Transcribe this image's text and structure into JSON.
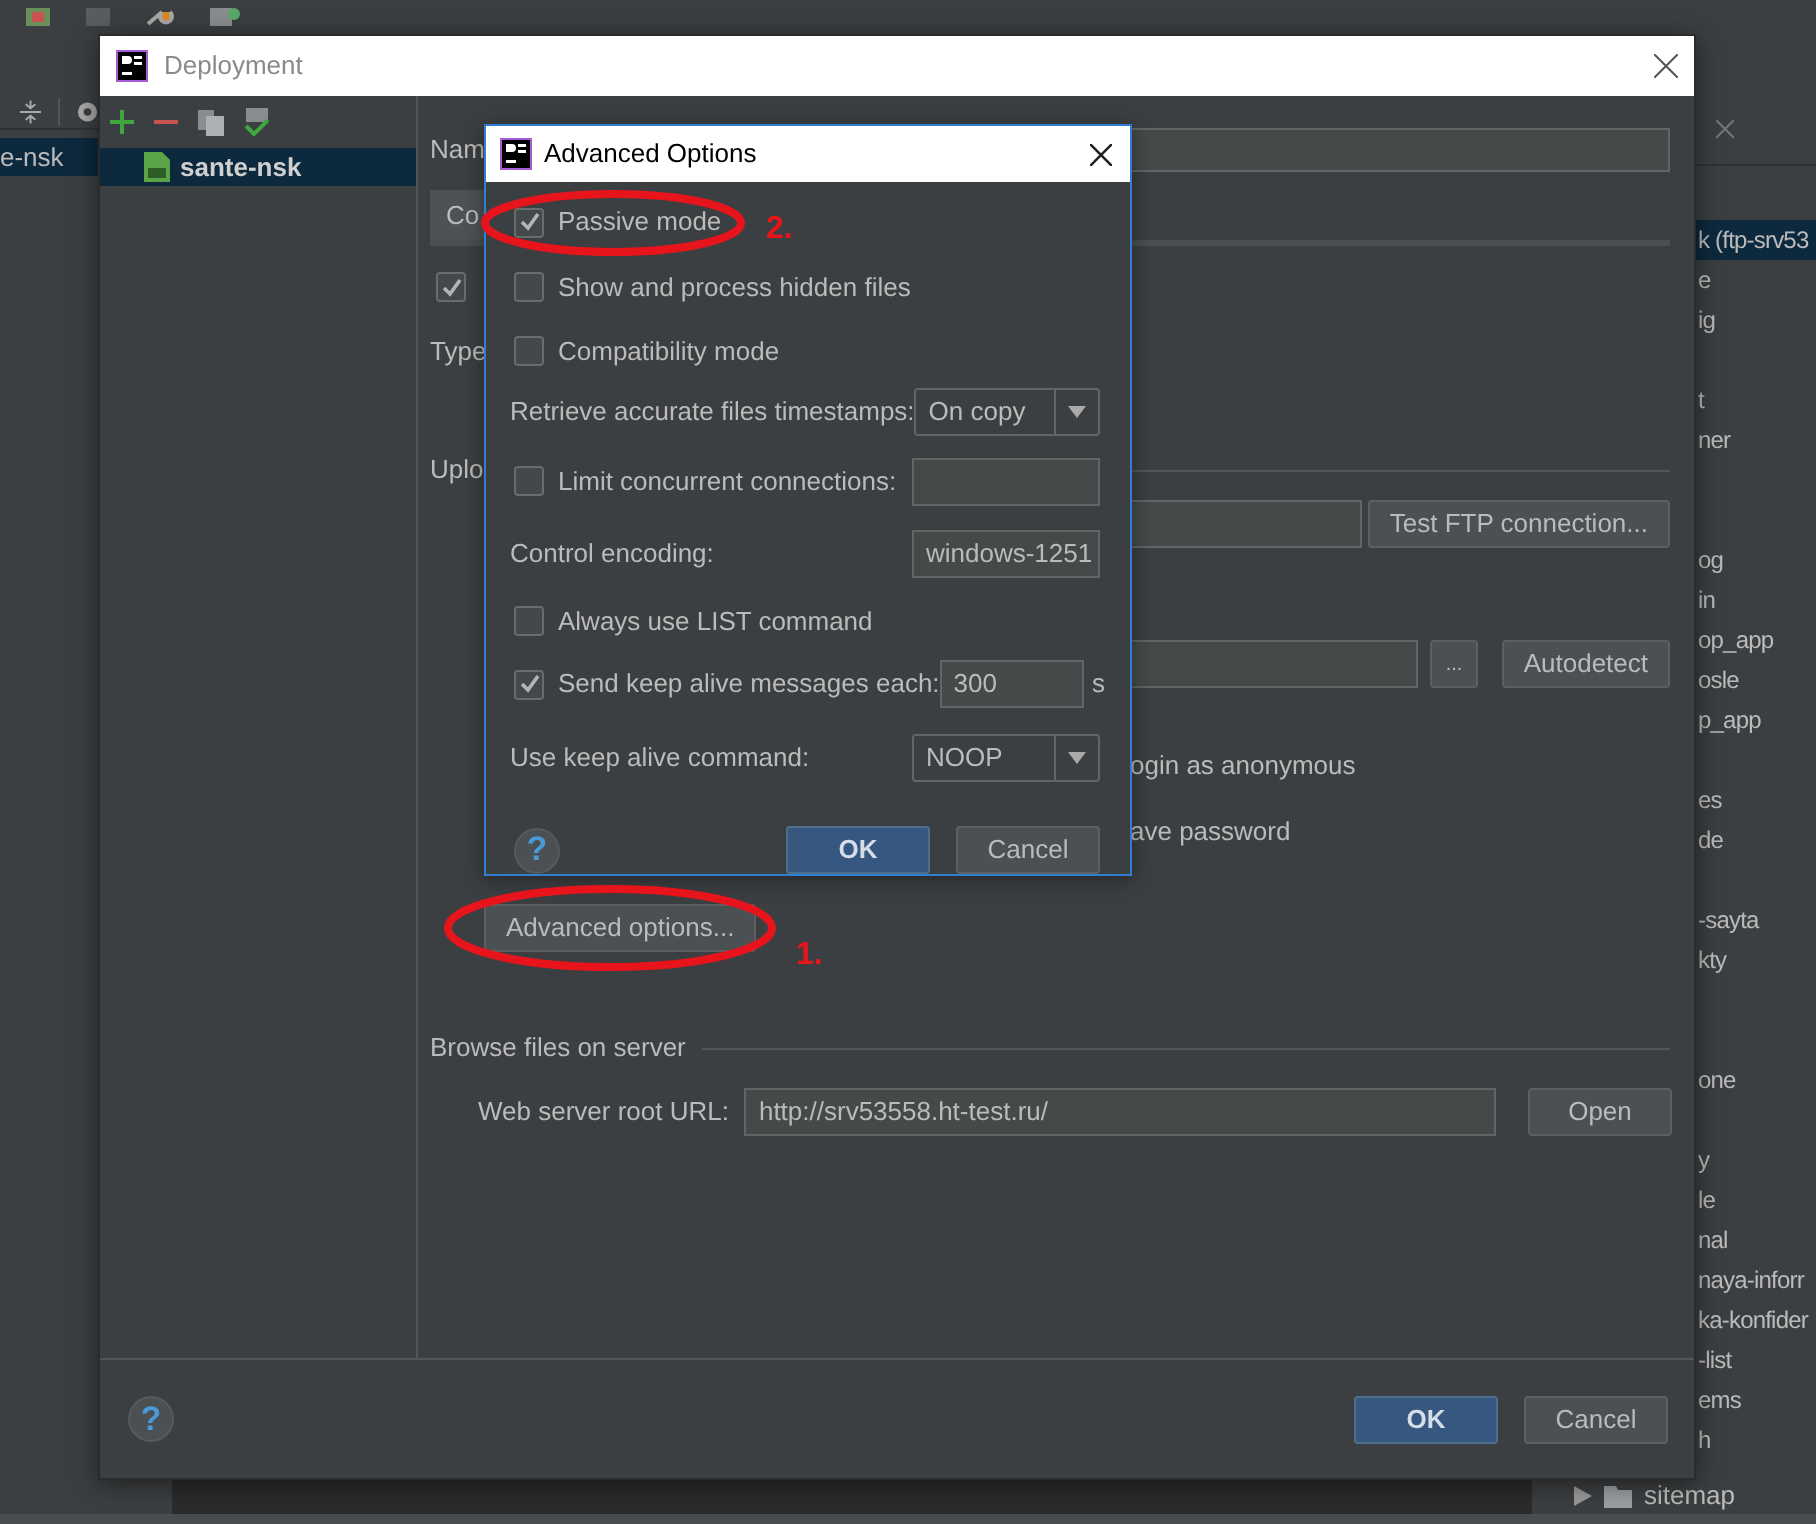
{
  "ide": {
    "left_item": {
      "label": "e-nsk",
      "selected": true
    },
    "right_items": [
      {
        "label": "k (ftp-srv53",
        "selected": true
      },
      {
        "label": "e",
        "selected": false
      },
      {
        "label": "ig",
        "selected": false
      },
      {
        "label": "t",
        "selected": false
      },
      {
        "label": "ner",
        "selected": false
      },
      {
        "label": "og",
        "selected": false
      },
      {
        "label": "in",
        "selected": false
      },
      {
        "label": "op_app",
        "selected": false
      },
      {
        "label": "osle",
        "selected": false
      },
      {
        "label": "p_app",
        "selected": false
      },
      {
        "label": "es",
        "selected": false
      },
      {
        "label": "de",
        "selected": false
      },
      {
        "label": "-sayta",
        "selected": false
      },
      {
        "label": "kty",
        "selected": false
      },
      {
        "label": "one",
        "selected": false
      },
      {
        "label": "y",
        "selected": false
      },
      {
        "label": "le",
        "selected": false
      },
      {
        "label": "nal",
        "selected": false
      },
      {
        "label": "naya-inforr",
        "selected": false
      },
      {
        "label": "ka-konfider",
        "selected": false
      },
      {
        "label": "-list",
        "selected": false
      },
      {
        "label": "ems",
        "selected": false
      },
      {
        "label": "h",
        "selected": false
      },
      {
        "label": "sitemap",
        "selected": false,
        "kind": "folder"
      }
    ]
  },
  "deployment": {
    "title": "Deployment",
    "servers": [
      {
        "label": "sante-nsk",
        "selected": true
      }
    ],
    "name_label": "Nam",
    "tabs": [
      {
        "label": "Co",
        "selected": true
      }
    ],
    "visible_checkbox": {
      "checked": true
    },
    "type_label": "Type",
    "upload_label": "Uplo",
    "test_button": "Test FTP connection...",
    "browse_button": "...",
    "autodetect_button": "Autodetect",
    "anonymous_label": "ogin as anonymous",
    "save_password_label": "ave password",
    "advanced_button": "Advanced options...",
    "browse_section": "Browse files on server",
    "web_root_label": "Web server root URL:",
    "web_root_value": "http://srv53558.ht-test.ru/",
    "open_button": "Open",
    "help_label": "?",
    "buttons": [
      {
        "label": "OK",
        "kind": "primary"
      },
      {
        "label": "Cancel",
        "kind": "secondary"
      }
    ]
  },
  "advanced": {
    "title": "Advanced Options",
    "rows": [
      {
        "kind": "checkbox",
        "label": "Passive mode",
        "checked": true
      },
      {
        "kind": "checkbox",
        "label": "Show and process hidden files",
        "checked": false
      },
      {
        "kind": "checkbox",
        "label": "Compatibility mode",
        "checked": false
      },
      {
        "kind": "dropdown",
        "label": "Retrieve accurate files timestamps:",
        "value": "On copy"
      },
      {
        "kind": "checkfield",
        "label": "Limit concurrent connections:",
        "checked": false
      },
      {
        "kind": "field",
        "label": "Control encoding:",
        "value": "windows-1251"
      },
      {
        "kind": "checkbox",
        "label": "Always use LIST command",
        "checked": false
      },
      {
        "kind": "checkfield",
        "label": "Send keep alive messages each:",
        "checked": true,
        "value": "300",
        "unit": "s"
      },
      {
        "kind": "dropdown",
        "label": "Use keep alive command:",
        "value": "NOOP"
      }
    ],
    "help_label": "?",
    "buttons": [
      {
        "label": "OK",
        "kind": "primary"
      },
      {
        "label": "Cancel",
        "kind": "secondary"
      }
    ]
  },
  "annotations": [
    {
      "label": "2."
    },
    {
      "label": "1."
    }
  ]
}
